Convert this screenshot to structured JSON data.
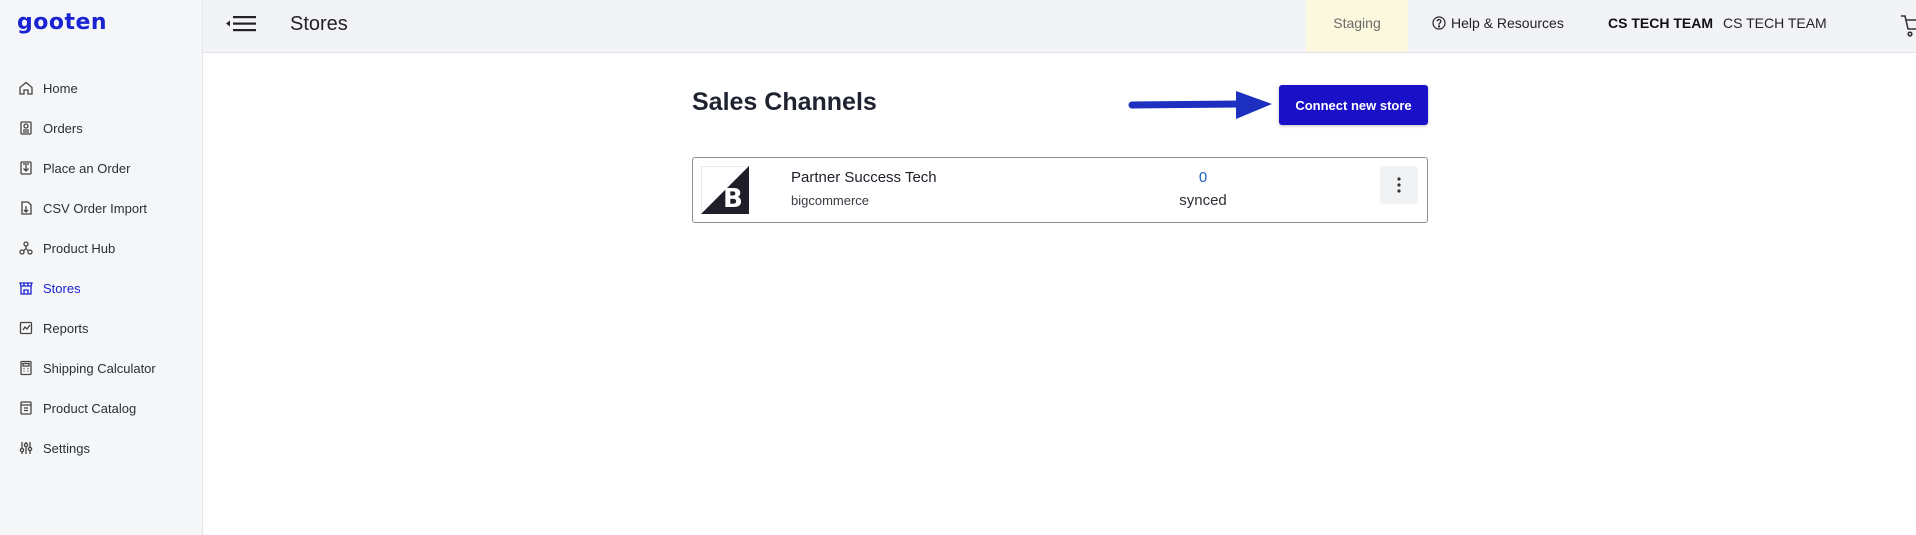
{
  "app": {
    "logo_text": "gooten",
    "brand_color": "#1a23d1"
  },
  "sidebar": {
    "items": [
      {
        "label": "Home",
        "icon": "home-icon",
        "active": false
      },
      {
        "label": "Orders",
        "icon": "orders-icon",
        "active": false
      },
      {
        "label": "Place an Order",
        "icon": "place-order-icon",
        "active": false
      },
      {
        "label": "CSV Order Import",
        "icon": "csv-import-icon",
        "active": false
      },
      {
        "label": "Product Hub",
        "icon": "product-hub-icon",
        "active": false
      },
      {
        "label": "Stores",
        "icon": "stores-icon",
        "active": true
      },
      {
        "label": "Reports",
        "icon": "reports-icon",
        "active": false
      },
      {
        "label": "Shipping Calculator",
        "icon": "calculator-icon",
        "active": false
      },
      {
        "label": "Product Catalog",
        "icon": "catalog-icon",
        "active": false
      },
      {
        "label": "Settings",
        "icon": "settings-sliders-icon",
        "active": false
      }
    ]
  },
  "header": {
    "title": "Stores",
    "environment_badge": "Staging",
    "help_label": "Help & Resources",
    "team_name_bold": "CS TECH TEAM",
    "team_name": "CS TECH TEAM"
  },
  "main": {
    "section_title": "Sales Channels",
    "connect_button_label": "Connect new store",
    "connect_button_color": "#1a10c8",
    "stores": [
      {
        "name": "Partner Success Tech",
        "platform": "bigcommerce",
        "synced_count": "0",
        "synced_label": "synced",
        "logo_icon": "bigcommerce-logo"
      }
    ]
  }
}
